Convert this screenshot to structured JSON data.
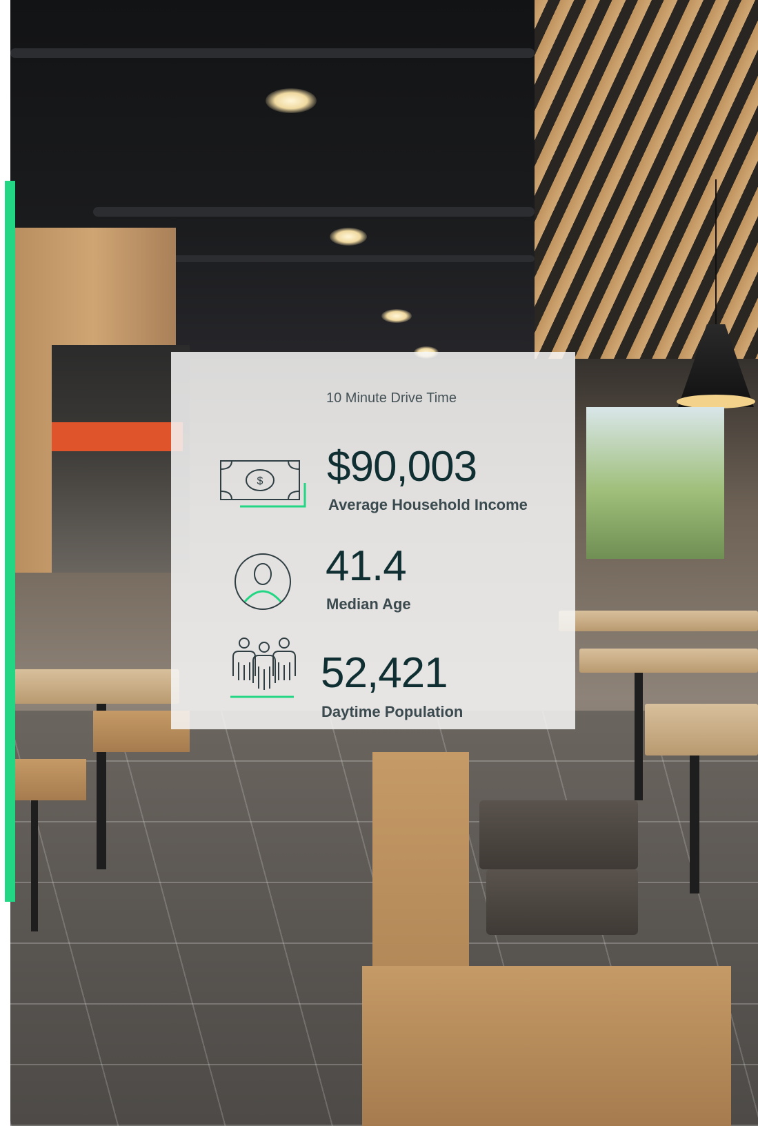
{
  "header": {
    "drive_time": "10 Minute Drive Time"
  },
  "stats": [
    {
      "value": "$90,003",
      "label": "Average Household Income",
      "icon": "money-bill-icon"
    },
    {
      "value": "41.4",
      "label": "Median Age",
      "icon": "person-circle-icon"
    },
    {
      "value": "52,421",
      "label": "Daytime Population",
      "icon": "people-group-icon"
    }
  ],
  "colors": {
    "accent": "#23d683",
    "value_text": "#0f2f32",
    "label_text": "#3a4a4e",
    "card_bg": "#f6f6f6"
  }
}
